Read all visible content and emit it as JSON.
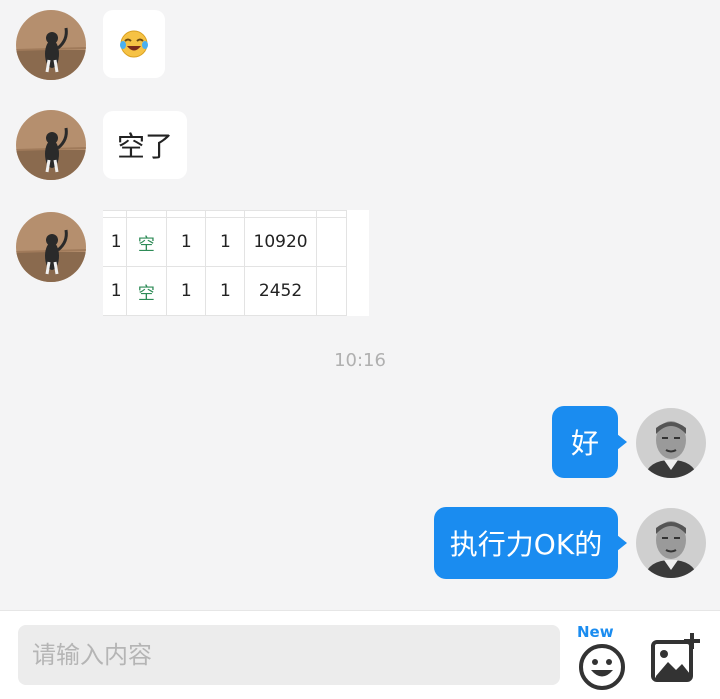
{
  "messages": [
    {
      "side": "in",
      "type": "emoji",
      "icon": "laughing-crying-emoji-icon"
    },
    {
      "side": "in",
      "type": "text",
      "text": "空了"
    },
    {
      "side": "in",
      "type": "table-snippet",
      "rows": [
        [
          "1",
          "空",
          "1",
          "1",
          "10920",
          ""
        ],
        [
          "1",
          "空",
          "1",
          "1",
          "2452",
          ""
        ]
      ]
    },
    {
      "side": "out",
      "type": "text",
      "text": "好"
    },
    {
      "side": "out",
      "type": "text",
      "text": "执行力OK的"
    }
  ],
  "timestamp": "10:16",
  "input": {
    "placeholder": "请输入内容",
    "emoji_badge": "New"
  },
  "colors": {
    "background": "#f4f4f5",
    "outgoing_bubble": "#1a8cf0",
    "incoming_bubble": "#ffffff",
    "table_accent": "#2e8b57"
  }
}
